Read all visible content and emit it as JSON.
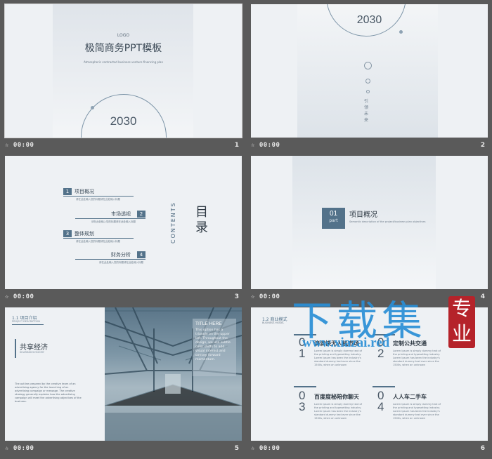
{
  "slides": [
    {
      "time": "00:00",
      "num": "1",
      "logo": "LOGO",
      "title": "极简商务PPT模板",
      "subtitle": "Atmospheric contracted business venture financing plan",
      "year": "2030"
    },
    {
      "time": "00:00",
      "num": "2",
      "year": "2030",
      "vertical": "引领未来"
    },
    {
      "time": "00:00",
      "num": "3",
      "contents_en": "CONTENTS",
      "contents_cn": "目录",
      "items": [
        {
          "n": "1",
          "title": "项目概况",
          "desc": "请在此处输入您的标题请在此处输入标题"
        },
        {
          "n": "2",
          "title": "市场透视",
          "desc": "请在此处输入您的标题请在此处输入标题"
        },
        {
          "n": "3",
          "title": "整体规划",
          "desc": "请在此处输入您的标题请在此处输入标题"
        },
        {
          "n": "4",
          "title": "财务分析",
          "desc": "请在此处输入您的标题请在此处输入标题"
        }
      ]
    },
    {
      "time": "00:00",
      "num": "4",
      "part_num": "01",
      "part_label": "part",
      "title": "项目概况",
      "desc": "Semantic description of the project/business plan objectives"
    },
    {
      "time": "00:00",
      "num": "5",
      "section": "1.1 项目介绍",
      "section_en": "PROJECT DESCRIPTION",
      "heading": "共享经济",
      "heading_en": "SHARINGECONOMY",
      "body": "The outline prepared by the creative team of an advertising agency for the launching of an advertising campaign or message. The creative strategy generally explains how the advertising campaign will meet the advertising objectives of the business.",
      "overlay_title": "TITLE HERE",
      "overlay_text": "This option has a triangle on the upper left. Throughout the design, we use subtle color shifts to add visual interest and convey forward momentum."
    },
    {
      "time": "00:00",
      "num": "6",
      "section": "1.2 商业模式",
      "section_en": "BUSINESS MODEL",
      "models": [
        {
          "n": "0\n1",
          "title": "滴滴快无人机市场",
          "desc": "Lorem Ipsum is simply dummy text of the printing and typesetting industry. Lorem Ipsum has been the industry's standard dummy text ever since the 1500s, when an unknown"
        },
        {
          "n": "0\n2",
          "title": "定制公共交通",
          "desc": "Lorem Ipsum is simply dummy text of the printing and typesetting industry. Lorem Ipsum has been the industry's standard dummy text ever since the 1500s, when an unknown"
        },
        {
          "n": "0\n3",
          "title": "百度度秘陪你聊天",
          "desc": "Lorem Ipsum is simply dummy text of the printing and typesetting industry. Lorem Ipsum has been the industry's standard dummy text ever since the 1500s, when an unknown"
        },
        {
          "n": "0\n4",
          "title": "人人车二手车",
          "desc": "Lorem Ipsum is simply dummy text of the printing and typesetting industry. Lorem Ipsum has been the industry's standard dummy text ever since the 1500s, when an unknown"
        }
      ]
    }
  ],
  "watermark": {
    "text": "下载集",
    "url": "www.xiazai.red",
    "stamp": "专业"
  },
  "colors": {
    "accent": "#53728a",
    "bg": "#5a5a5a",
    "slide": "#eef1f4"
  }
}
